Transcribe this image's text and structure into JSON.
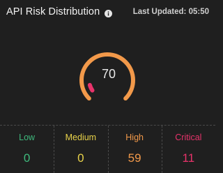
{
  "header": {
    "title": "API Risk Distribution",
    "info_icon": "info-icon",
    "last_updated": "Last Updated: 05:50"
  },
  "gauge": {
    "score": "70",
    "score_value": 70,
    "max": 100,
    "track_color": "#f2994a",
    "indicator_color": "#e8336b"
  },
  "stats": [
    {
      "label": "Low",
      "value": "0",
      "color": "#3fba7d"
    },
    {
      "label": "Medium",
      "value": "0",
      "color": "#e8d24a"
    },
    {
      "label": "High",
      "value": "59",
      "color": "#f2994a"
    },
    {
      "label": "Critical",
      "value": "11",
      "color": "#e8336b"
    }
  ]
}
